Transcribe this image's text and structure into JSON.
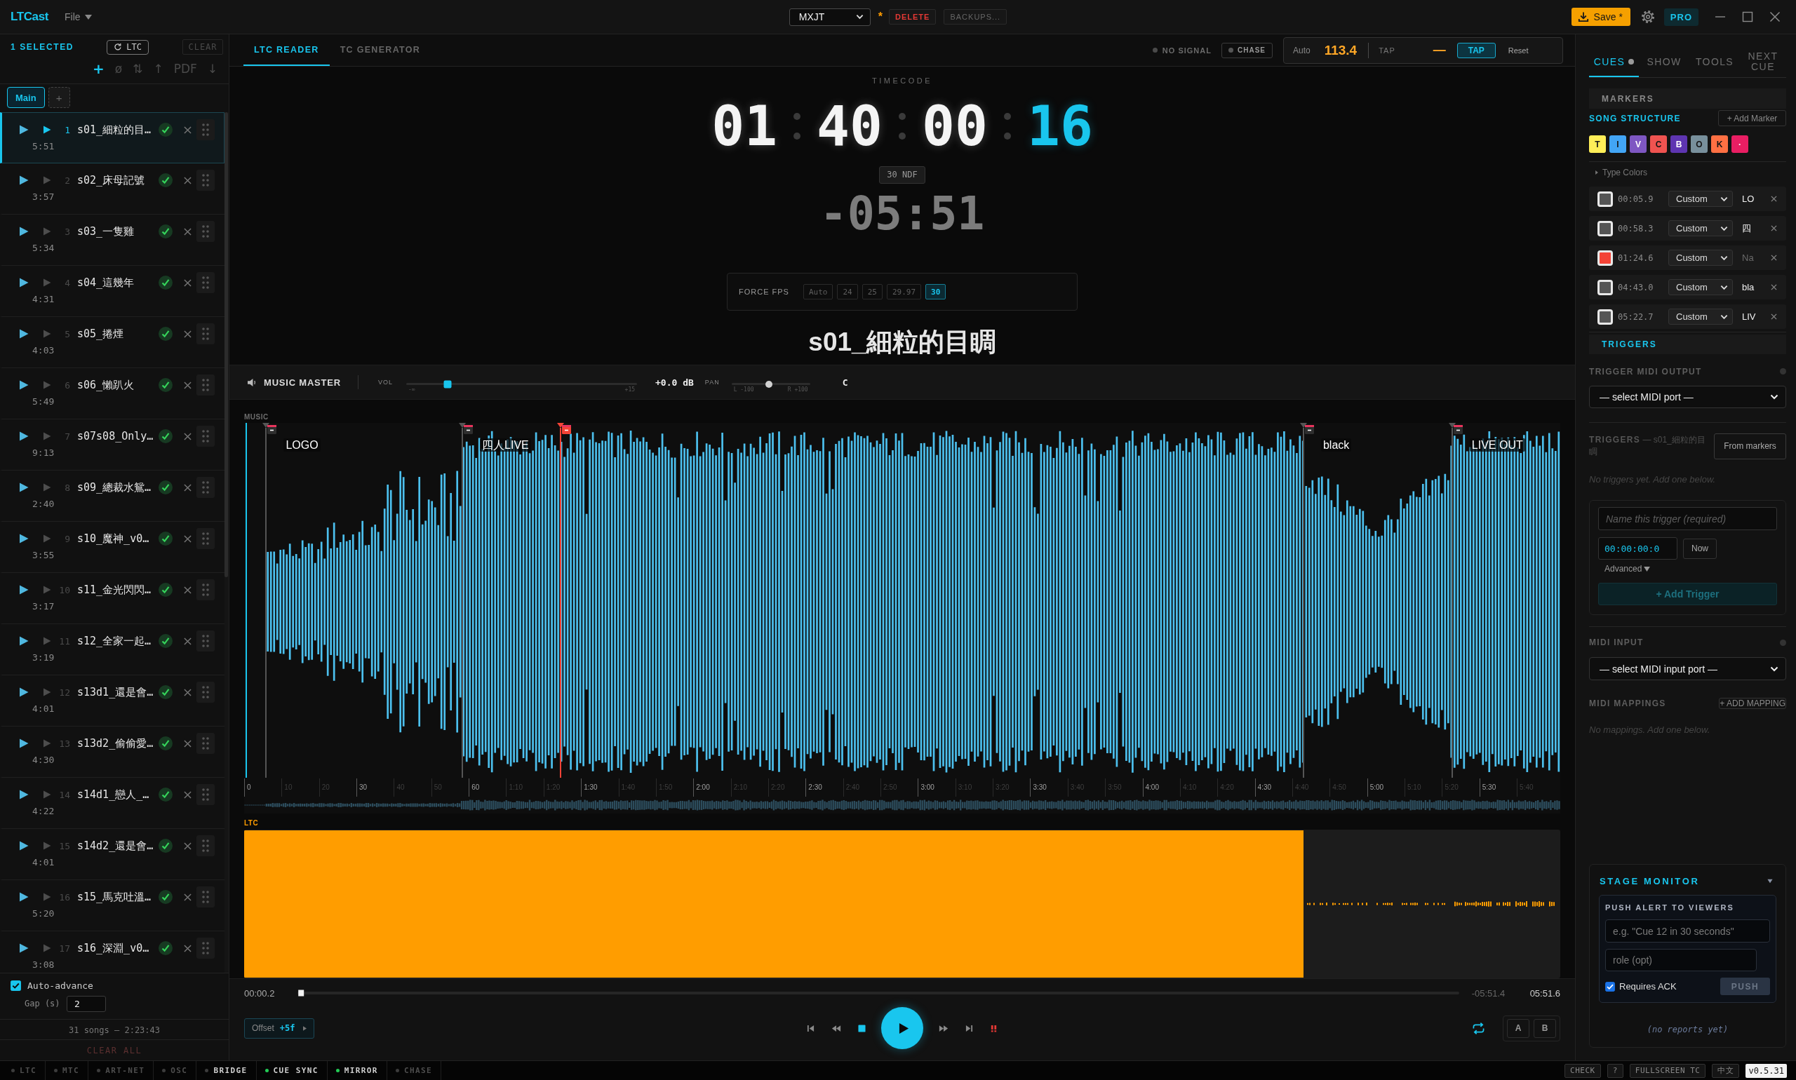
{
  "title_bar": {
    "app_name": "LTCast",
    "menu": "File",
    "project": "MXJT",
    "unsaved_mark": "*",
    "delete_button": "DELETE",
    "backups_button": "BACKUPS...",
    "save_button": "Save *",
    "plan_badge": "PRO"
  },
  "sidebar": {
    "selection_count": "1 SELECTED",
    "ltc_button": "LTC",
    "clear_button": "CLEAR",
    "tools": [
      {
        "label": "+",
        "disabled": false
      },
      {
        "label": "ø",
        "disabled": true
      },
      {
        "label": "⇅",
        "disabled": true
      },
      {
        "label": "↑",
        "disabled": true
      },
      {
        "label": "PDF",
        "disabled": true
      },
      {
        "label": "↓",
        "disabled": true
      }
    ],
    "tabs": [
      {
        "label": "Main",
        "selected": true
      }
    ],
    "add_tab": "+",
    "songs": [
      {
        "number": "1",
        "name": "s01_細粒的目…",
        "duration": "5:51",
        "selected": true,
        "ready": true
      },
      {
        "number": "2",
        "name": "s02_床母記號",
        "duration": "3:57",
        "selected": false,
        "ready": true
      },
      {
        "number": "3",
        "name": "s03_一隻雞",
        "duration": "5:34",
        "selected": false,
        "ready": true
      },
      {
        "number": "4",
        "name": "s04_這幾年",
        "duration": "4:31",
        "selected": false,
        "ready": true
      },
      {
        "number": "5",
        "name": "s05_捲煙",
        "duration": "4:03",
        "selected": false,
        "ready": true
      },
      {
        "number": "6",
        "name": "s06_懶趴火",
        "duration": "5:49",
        "selected": false,
        "ready": true
      },
      {
        "number": "7",
        "name": "s07s08_Only…",
        "duration": "9:13",
        "selected": false,
        "ready": true
      },
      {
        "number": "8",
        "name": "s09_總裁水鴛…",
        "duration": "2:40",
        "selected": false,
        "ready": true
      },
      {
        "number": "9",
        "name": "s10_魔神_v0…",
        "duration": "3:55",
        "selected": false,
        "ready": true
      },
      {
        "number": "10",
        "name": "s11_金光閃閃…",
        "duration": "3:17",
        "selected": false,
        "ready": true
      },
      {
        "number": "11",
        "name": "s12_全家一起…",
        "duration": "3:19",
        "selected": false,
        "ready": true
      },
      {
        "number": "12",
        "name": "s13d1_還是會…",
        "duration": "4:01",
        "selected": false,
        "ready": true
      },
      {
        "number": "13",
        "name": "s13d2_偷偷愛…",
        "duration": "4:30",
        "selected": false,
        "ready": true
      },
      {
        "number": "14",
        "name": "s14d1_戀人_…",
        "duration": "4:22",
        "selected": false,
        "ready": true
      },
      {
        "number": "15",
        "name": "s14d2_還是會…",
        "duration": "4:01",
        "selected": false,
        "ready": true
      },
      {
        "number": "16",
        "name": "s15_馬克吐溫…",
        "duration": "5:20",
        "selected": false,
        "ready": true
      },
      {
        "number": "17",
        "name": "s16_深淵_v0…",
        "duration": "3:08",
        "selected": false,
        "ready": true
      }
    ],
    "auto_advance": {
      "label": "Auto-advance",
      "checked": true
    },
    "gap": {
      "label": "Gap (s)",
      "value": "2"
    },
    "summary": "31 songs — 2:23:43",
    "clear_all": "CLEAR ALL"
  },
  "reader": {
    "tabs": [
      {
        "label": "LTC READER",
        "selected": true
      },
      {
        "label": "TC GENERATOR",
        "selected": false
      }
    ],
    "signal": {
      "label": "NO SIGNAL",
      "on": false
    },
    "chase": {
      "label": "CHASE",
      "on": false
    },
    "bpm": {
      "mode": "Auto",
      "value": "113.4",
      "tap_label": "TAP",
      "tap_value": "—",
      "tap_button": "TAP",
      "reset_button": "Reset"
    },
    "timecode_label": "TIMECODE",
    "timecode": [
      {
        "value": "01",
        "highlight": false
      },
      {
        "value": "40",
        "highlight": false
      },
      {
        "value": "00",
        "highlight": false
      },
      {
        "value": "16",
        "highlight": true
      }
    ],
    "frame_rate": "30 NDF",
    "countdown": "-05:51",
    "force_fps": {
      "label": "FORCE FPS",
      "options": [
        {
          "label": "Auto",
          "selected": false
        },
        {
          "label": "24",
          "selected": false
        },
        {
          "label": "25",
          "selected": false
        },
        {
          "label": "29.97",
          "selected": false
        },
        {
          "label": "30",
          "selected": true
        }
      ]
    },
    "song_title": "s01_細粒的目睭"
  },
  "music_master": {
    "title": "MUSIC MASTER",
    "vol_label": "VOL",
    "volume": {
      "level": 0.18,
      "min": "-∞",
      "max": "+15"
    },
    "volume_reading": "+0.0 dB",
    "pan_label": "PAN",
    "pan": {
      "level": 0.48,
      "min": "L -100",
      "max": "R +100"
    },
    "pan_reading": "C"
  },
  "waveform": {
    "label": "MUSIC",
    "markers": [
      {
        "label": "LOGO",
        "color": "#555555"
      },
      {
        "label": "四人LIVE",
        "color": "#555555"
      },
      {
        "color": "#f44336"
      },
      {
        "label": "black",
        "color": "#555555"
      },
      {
        "label": "LIVE OUT",
        "color": "#555555"
      }
    ],
    "ticks": [
      {
        "label": "0",
        "major": true
      },
      {
        "label": "10",
        "major": false
      },
      {
        "label": "20",
        "major": false
      },
      {
        "label": "30",
        "major": true
      },
      {
        "label": "40",
        "major": false
      },
      {
        "label": "50",
        "major": false
      },
      {
        "label": "60",
        "major": true
      },
      {
        "label": "1:10",
        "major": false
      },
      {
        "label": "1:20",
        "major": false
      },
      {
        "label": "1:30",
        "major": true
      },
      {
        "label": "1:40",
        "major": false
      },
      {
        "label": "1:50",
        "major": false
      },
      {
        "label": "2:00",
        "major": true
      },
      {
        "label": "2:10",
        "major": false
      },
      {
        "label": "2:20",
        "major": false
      },
      {
        "label": "2:30",
        "major": true
      },
      {
        "label": "2:40",
        "major": false
      },
      {
        "label": "2:50",
        "major": false
      },
      {
        "label": "3:00",
        "major": true
      },
      {
        "label": "3:10",
        "major": false
      },
      {
        "label": "3:20",
        "major": false
      },
      {
        "label": "3:30",
        "major": true
      },
      {
        "label": "3:40",
        "major": false
      },
      {
        "label": "3:50",
        "major": false
      },
      {
        "label": "4:00",
        "major": true
      },
      {
        "label": "4:10",
        "major": false
      },
      {
        "label": "4:20",
        "major": false
      },
      {
        "label": "4:30",
        "major": true
      },
      {
        "label": "4:40",
        "major": false
      },
      {
        "label": "4:50",
        "major": false
      },
      {
        "label": "5:00",
        "major": true
      },
      {
        "label": "5:10",
        "major": false
      },
      {
        "label": "5:20",
        "major": false
      },
      {
        "label": "5:30",
        "major": true
      },
      {
        "label": "5:40",
        "major": false
      }
    ]
  },
  "ltc": {
    "label": "LTC"
  },
  "transport": {
    "elapsed": "00:00.2",
    "position": {
      "level": 0.001
    },
    "remaining": "-05:51.4",
    "duration": "05:51.6",
    "offset": {
      "label": "Offset",
      "value": "+5f"
    },
    "loop": {
      "on": true
    },
    "ab_buttons": [
      "A",
      "B"
    ]
  },
  "cues_panel": {
    "tabs": [
      {
        "label": "CUES",
        "selected": true,
        "dot": true
      },
      {
        "label": "SHOW",
        "selected": false,
        "dot": false
      },
      {
        "label": "TOOLS",
        "selected": false,
        "dot": false
      },
      {
        "label": "NEXT CUE",
        "selected": false,
        "dot": false
      }
    ],
    "markers_header": "MARKERS",
    "structure_label": "SONG STRUCTURE",
    "add_marker": "+ Add Marker",
    "structure_types": [
      {
        "label": "T",
        "color": "#ffee58"
      },
      {
        "label": "I",
        "color": "#42a5f5"
      },
      {
        "label": "V",
        "color": "#7e57c2"
      },
      {
        "label": "C",
        "color": "#ef5350"
      },
      {
        "label": "B",
        "color": "#5e35b1"
      },
      {
        "label": "O",
        "color": "#78909c"
      },
      {
        "label": "K",
        "color": "#ff7043"
      },
      {
        "label": "·",
        "color": "#e91e63"
      }
    ],
    "type_colors": {
      "label": "Type Colors",
      "expanded": false
    },
    "markers": [
      {
        "color": "#555555",
        "time": "00:05.9",
        "type": "Custom",
        "name": "LO"
      },
      {
        "color": "#555555",
        "time": "00:58.3",
        "type": "Custom",
        "name": "四"
      },
      {
        "color": "#f44336",
        "time": "01:24.6",
        "type": "Custom",
        "placeholder": "Na"
      },
      {
        "color": "#555555",
        "time": "04:43.0",
        "type": "Custom",
        "name": "bla"
      },
      {
        "color": "#555555",
        "time": "05:22.7",
        "type": "Custom",
        "name": "LIV"
      }
    ],
    "triggers_header": "TRIGGERS",
    "midi_output": {
      "label": "TRIGGER MIDI OUTPUT",
      "connected": false,
      "select": "— select MIDI port —"
    },
    "triggers": {
      "title": "**TRIGGERS** — s01_細粒的目睭",
      "from_markers": "From markers",
      "empty": "No triggers yet. Add one below.",
      "name_placeholder": "Name this trigger (required)",
      "time": "00:00:00:0",
      "now": "Now",
      "advanced": "Advanced",
      "add": "+ Add Trigger"
    },
    "midi_input": {
      "label": "MIDI INPUT",
      "connected": false,
      "select": "— select MIDI input port —"
    },
    "mappings": {
      "label": "MIDI MAPPINGS",
      "add": "+ ADD MAPPING",
      "empty": "No mappings. Add one below."
    },
    "stage_monitor": {
      "title": "STAGE MONITOR",
      "expanded": true,
      "push_title": "PUSH ALERT TO VIEWERS",
      "message_placeholder": "e.g. \"Cue 12 in 30 seconds\"",
      "role_placeholder": "role (opt)",
      "requires_ack": {
        "label": "Requires ACK",
        "checked": true
      },
      "push": "PUSH",
      "reports": "(no reports yet)"
    }
  },
  "status_bar": {
    "items": [
      {
        "label": "LTC",
        "enabled": false,
        "on": false
      },
      {
        "label": "MTC",
        "enabled": false,
        "on": false
      },
      {
        "label": "ART-NET",
        "enabled": false,
        "on": false
      },
      {
        "label": "OSC",
        "enabled": false,
        "on": false
      },
      {
        "label": "BRIDGE",
        "enabled": true,
        "on": false
      },
      {
        "label": "CUE SYNC",
        "enabled": true,
        "on": true
      },
      {
        "label": "MIRROR",
        "enabled": true,
        "on": true
      },
      {
        "label": "CHASE",
        "enabled": false,
        "on": false
      }
    ],
    "actions": [
      "CHECK",
      "?",
      "FULLSCREEN TC",
      "中文"
    ],
    "version": "v0.5.31"
  }
}
